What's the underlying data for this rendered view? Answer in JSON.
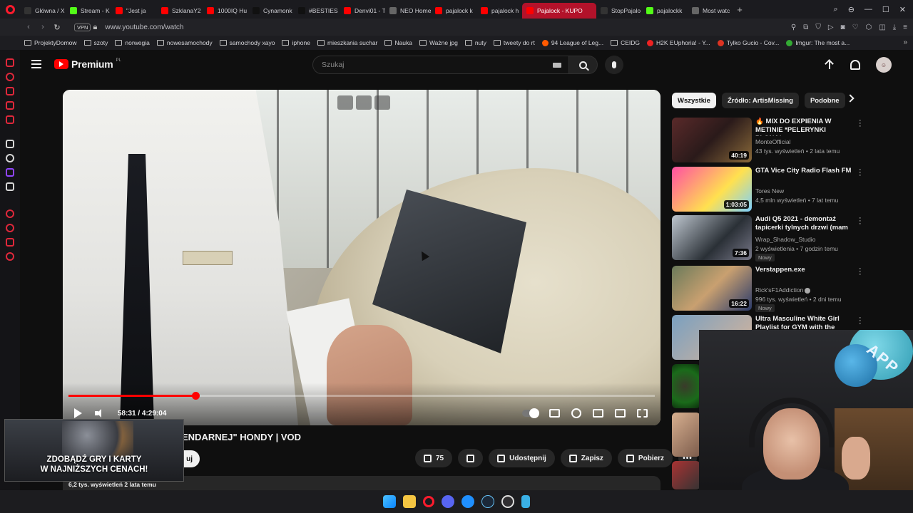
{
  "browser": {
    "tabs": [
      {
        "label": "Główna / X",
        "icon": "x-icon"
      },
      {
        "label": "Stream - K",
        "icon": "kick-icon"
      },
      {
        "label": "\"Jest ja",
        "icon": "youtube-icon"
      },
      {
        "label": "SzklanaY2",
        "icon": "youtube-icon"
      },
      {
        "label": "1000IQ Hu",
        "icon": "youtube-icon"
      },
      {
        "label": "Cynamonk",
        "icon": "tiktok-icon"
      },
      {
        "label": "#BESTIES a",
        "icon": "tiktok-icon"
      },
      {
        "label": "Denvi01 - T",
        "icon": "youtube-icon"
      },
      {
        "label": "NEO Home",
        "icon": "page-icon"
      },
      {
        "label": "pajalock k",
        "icon": "youtube-icon"
      },
      {
        "label": "pajalock h",
        "icon": "youtube-icon"
      },
      {
        "label": "Pajalock - KUPO",
        "icon": "youtube-icon",
        "active": true
      },
      {
        "label": "StopPajalo",
        "icon": "x-icon"
      },
      {
        "label": "pajalockk",
        "icon": "kick-icon"
      },
      {
        "label": "Most watc",
        "icon": "page-icon"
      }
    ],
    "vpn_label": "VPN",
    "url": "www.youtube.com/watch",
    "bookmarks": [
      "ProjektyDomow",
      "szoty",
      "norwegia",
      "nowesamochody",
      "samochody xayo",
      "iphone",
      "mieszkania suchar",
      "Nauka",
      "Ważne jpg",
      "nuty",
      "tweety do rt",
      "94 League of Leg...",
      "CEIDG",
      "H2K EUphoria! - Y...",
      "Tylko Gucio - Cov...",
      "Imgur: The most a..."
    ]
  },
  "youtube": {
    "logo_text": "Premium",
    "logo_country": "PL",
    "search_placeholder": "Szukaj",
    "player": {
      "current_time": "58:31",
      "duration": "4:29:04",
      "time_display": "58:31 / 4:29:04",
      "progress": 0.217
    },
    "video_title_visible": "ENDARNEJ\" HONDY | VOD",
    "subscribe_label_visible": "uj",
    "actions": {
      "likes": "75",
      "share": "Udostępnij",
      "save": "Zapisz",
      "download": "Pobierz"
    },
    "chips": [
      "Wszystkie",
      "Źródło: ArtisMissing",
      "Podobne"
    ],
    "recommendations": [
      {
        "title": "🔥 MIX DO EXPIENIA W METINIE *PELERYNKI PŁONĄ*",
        "channel": "MonteOfficial",
        "meta": "43 tys. wyświetleń • 2 lata temu",
        "duration": "40:19",
        "badge": ""
      },
      {
        "title": "GTA Vice City Radio Flash FM",
        "channel": "Tores New",
        "meta": "4,5 mln wyświetleń • 7 lat temu",
        "duration": "1:03:05",
        "badge": ""
      },
      {
        "title": "Audi Q5 2021 - demontaż tapicerki tylnych drzwi (mam ...",
        "channel": "Wrap_Shadow_Studio",
        "meta": "2 wyświetlenia • 7 godzin temu",
        "duration": "7:36",
        "badge": "Nowy"
      },
      {
        "title": "Verstappen.exe",
        "channel": "Rick'sF1Addiction",
        "meta": "996 tys. wyświetleń • 2 dni temu",
        "duration": "16:22",
        "badge": "Nowy"
      },
      {
        "title": "Ultra Masculine White Girl Playlist for GYM with the Boys",
        "channel": "",
        "meta": "",
        "duration": "",
        "badge": ""
      }
    ]
  },
  "ad_overlay": {
    "line1": "ZDOBĄDŹ GRY I KARTY",
    "line2": "W NAJNIŻSZYCH CENACH!",
    "meta": "6,2 tys. wyświetleń  2 lata temu"
  },
  "webcam": {
    "overlay_text": "APP"
  },
  "colors": {
    "accent": "#ff0000",
    "opera": "#ff1b2d",
    "active_tab": "#b3122a"
  }
}
